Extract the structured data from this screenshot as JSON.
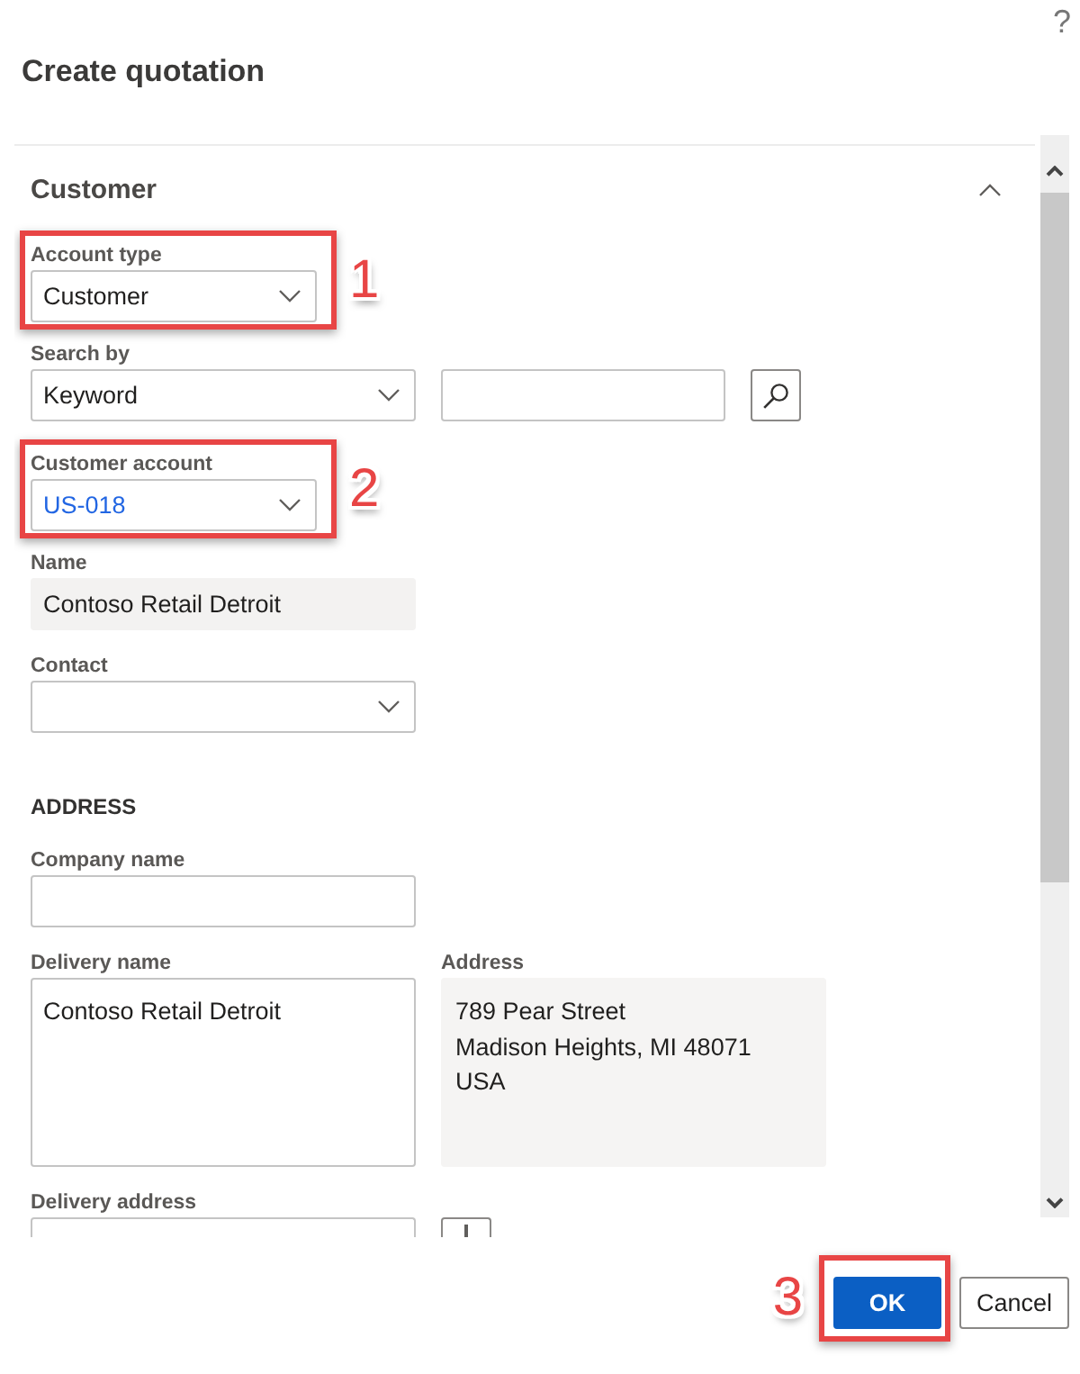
{
  "dialog": {
    "help": "?",
    "title": "Create quotation"
  },
  "section": {
    "title": "Customer",
    "expanded": true
  },
  "fields": [
    {
      "kind": "dropdown",
      "label": "Account type",
      "value": "Customer",
      "link": false,
      "highlighted": true,
      "callout": "1"
    },
    {
      "kind": "search",
      "label": "Search by",
      "value": "Keyword",
      "link": false,
      "highlighted": false
    },
    {
      "kind": "dropdown",
      "label": "Customer account",
      "value": "US-018",
      "link": true,
      "highlighted": true,
      "callout": "2"
    },
    {
      "kind": "readonly",
      "label": "Name",
      "value": "Contoso Retail Detroit",
      "highlighted": false
    },
    {
      "kind": "dropdown",
      "label": "Contact",
      "highlighted": false
    },
    {
      "kind": "heading",
      "text": "ADDRESS",
      "highlighted": false
    },
    {
      "kind": "text",
      "label": "Company name",
      "highlighted": false
    },
    {
      "kind": "pair",
      "highlighted": false,
      "columns": [
        {
          "kind": "textarea",
          "label": "Delivery name",
          "value": "Contoso Retail Detroit"
        },
        {
          "kind": "readonly",
          "label": "Address",
          "lines": [
            "789 Pear Street",
            "Madison Heights, MI 48071",
            "USA"
          ]
        }
      ]
    },
    {
      "kind": "dropdown",
      "label": "Delivery address",
      "add_button": true,
      "highlighted": false
    }
  ],
  "buttons": [
    {
      "label": "OK",
      "kind": "primary",
      "highlighted": true,
      "callout": "3"
    },
    {
      "label": "Cancel",
      "kind": "secondary",
      "highlighted": false
    }
  ]
}
